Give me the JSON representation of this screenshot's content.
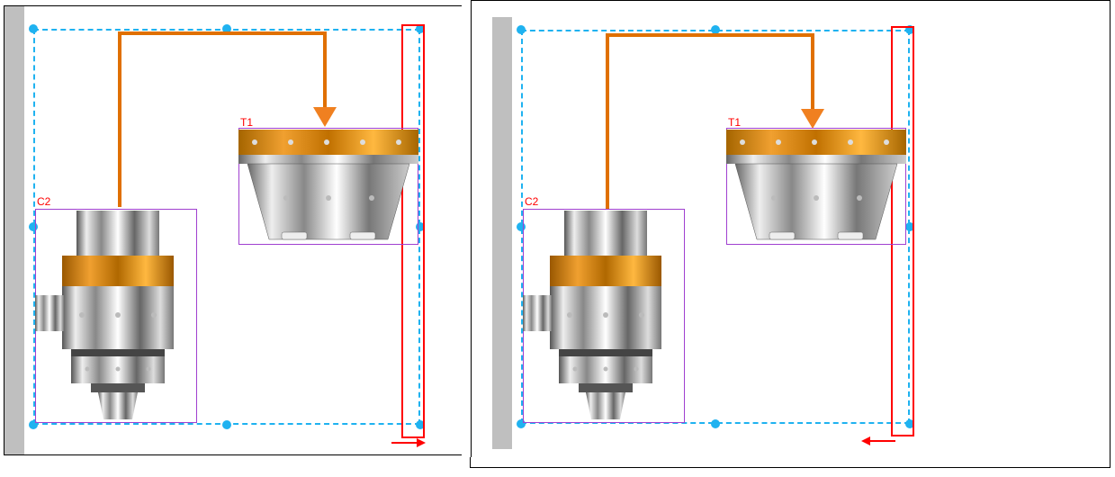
{
  "panels": {
    "left": {
      "labels": {
        "c2": "C2",
        "t1": "T1"
      },
      "arrow_direction": "right"
    },
    "right": {
      "labels": {
        "c2": "C2",
        "t1": "T1"
      },
      "arrow_direction": "left"
    }
  },
  "colors": {
    "selection": "#1fb2f0",
    "thread_box": "#ff0000",
    "component_box": "#a040d0",
    "flow_arrow": "#e07000",
    "grey_bar": "#bfbfbf"
  }
}
